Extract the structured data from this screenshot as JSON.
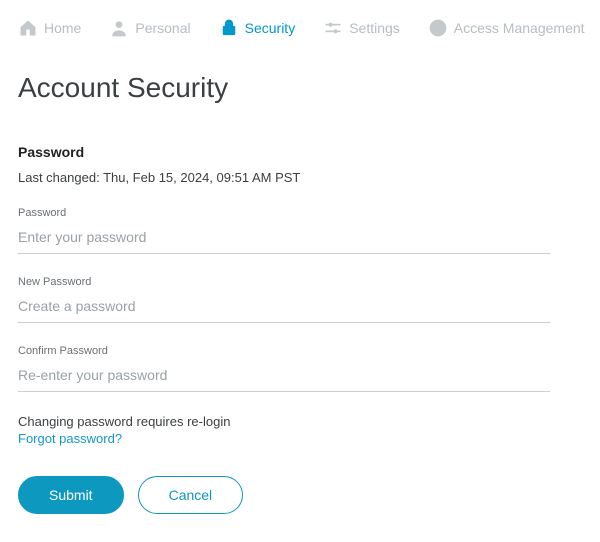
{
  "nav": {
    "home": "Home",
    "personal": "Personal",
    "security": "Security",
    "settings": "Settings",
    "access": "Access Management"
  },
  "page": {
    "title": "Account Security",
    "section_label": "Password",
    "last_changed_prefix": "Last changed: ",
    "last_changed_value": "Thu, Feb 15, 2024, 09:51 AM PST",
    "note": "Changing password requires re-login",
    "forgot": "Forgot password?",
    "submit": "Submit",
    "cancel": "Cancel"
  },
  "fields": {
    "current": {
      "label": "Password",
      "placeholder": "Enter your password",
      "value": ""
    },
    "new": {
      "label": "New Password",
      "placeholder": "Create a password",
      "value": ""
    },
    "confirm": {
      "label": "Confirm Password",
      "placeholder": "Re-enter your password",
      "value": ""
    }
  }
}
